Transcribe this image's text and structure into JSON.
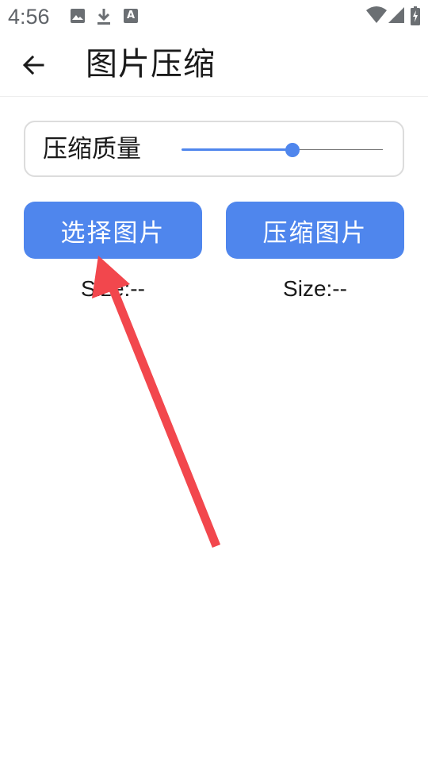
{
  "status_bar": {
    "time": "4:56",
    "icons_left": [
      "image-icon",
      "download-icon",
      "a-badge-icon"
    ],
    "icons_right": [
      "wifi-icon",
      "signal-icon",
      "battery-charging-icon"
    ],
    "a_badge_text": "A"
  },
  "app_bar": {
    "title": "图片压缩",
    "back_icon": "arrow-left-icon"
  },
  "quality": {
    "label": "压缩质量",
    "value_fraction": 0.55,
    "accent": "#4f86ed"
  },
  "buttons": {
    "select_label": "选择图片",
    "compress_label": "压缩图片"
  },
  "sizes": {
    "original": "Size:--",
    "compressed": "Size:--"
  },
  "annotation": {
    "color": "#f2474d",
    "icon": "red-arrow-annotation"
  }
}
